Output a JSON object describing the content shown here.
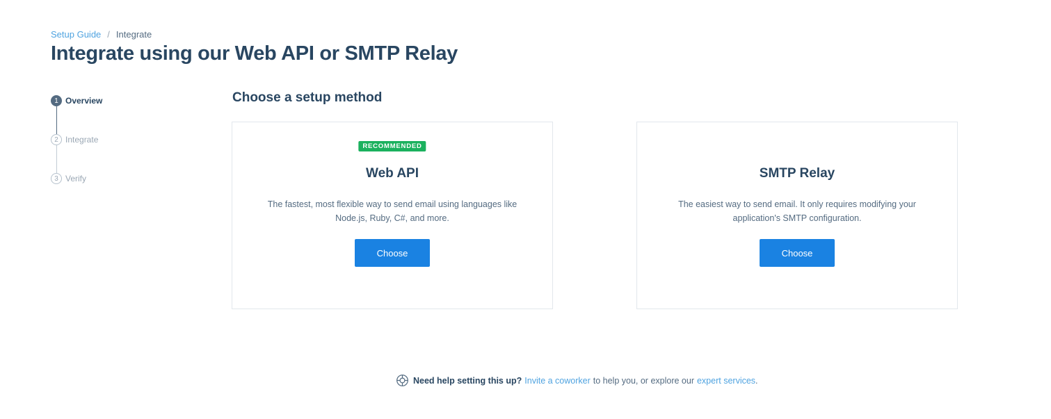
{
  "breadcrumb": {
    "parent": "Setup Guide",
    "separator": "/",
    "current": "Integrate"
  },
  "page": {
    "title": "Integrate using our Web API or SMTP Relay"
  },
  "steps": [
    {
      "number": "1",
      "label": "Overview",
      "state": "active"
    },
    {
      "number": "2",
      "label": "Integrate",
      "state": "inactive"
    },
    {
      "number": "3",
      "label": "Verify",
      "state": "inactive"
    }
  ],
  "main": {
    "section_title": "Choose a setup method",
    "cards": [
      {
        "badge": "RECOMMENDED",
        "title": "Web API",
        "description": "The fastest, most flexible way to send email using languages like Node.js, Ruby, C#, and more.",
        "button_label": "Choose"
      },
      {
        "title": "SMTP Relay",
        "description": "The easiest way to send email. It only requires modifying your application's SMTP configuration.",
        "button_label": "Choose"
      }
    ]
  },
  "help": {
    "icon": "lifebuoy-icon",
    "question": "Need help setting this up?",
    "invite_link": "Invite a coworker",
    "middle_text": "to help you, or explore our",
    "expert_link": "expert services",
    "end": "."
  },
  "colors": {
    "primary_button": "#1a82e2",
    "badge_green": "#1bb15e",
    "heading": "#294661",
    "link": "#4fa3e0"
  }
}
